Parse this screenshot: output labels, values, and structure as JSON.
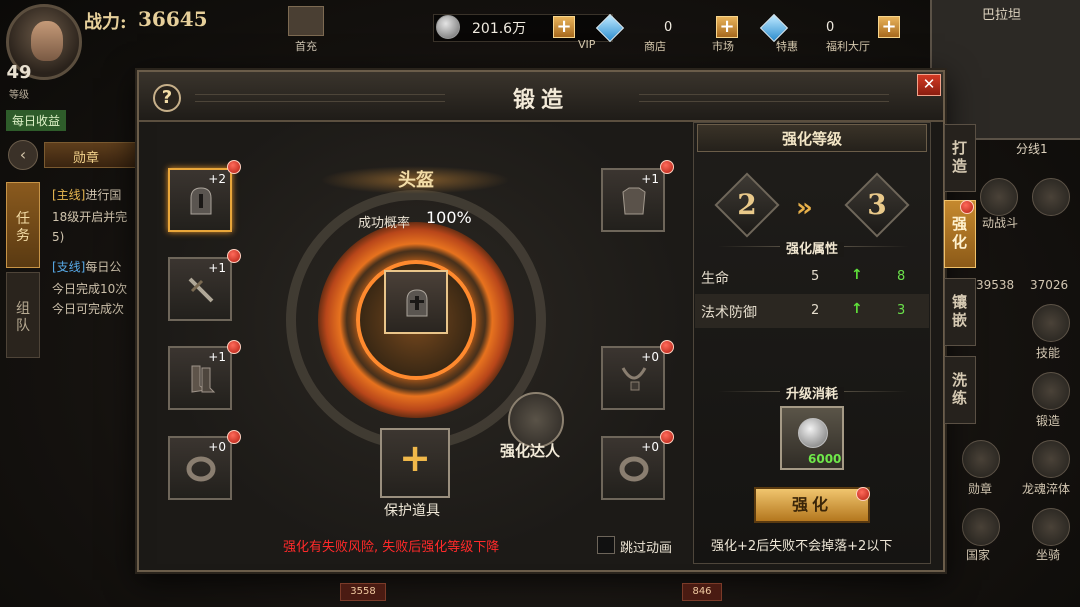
{
  "hud": {
    "power_label": "战力:",
    "power_value": "36645",
    "level_value": "49",
    "level_label": "等级",
    "gift_label": "首充",
    "coin_value": "201.6万",
    "vip_label": "VIP",
    "gem_value": "0",
    "shop_label": "商店",
    "market_label": "市场",
    "special_label": "特惠",
    "gem2_value": "0",
    "welfare_label": "福利大厅",
    "map_title": "巴拉坦",
    "map_line": "分线1"
  },
  "left": {
    "daily_label": "每日收益",
    "medal_tab": "勋章",
    "task_tab": "任务",
    "team_tab": "组队",
    "quests": [
      {
        "tag": "[主线]",
        "text": "进行国"
      },
      {
        "tag": "",
        "text": "18级开启并完"
      },
      {
        "tag": "",
        "text": "5)"
      },
      {
        "tag": "[支线]",
        "text": "每日公"
      },
      {
        "tag": "",
        "text": "今日完成10次"
      },
      {
        "tag": "",
        "text": "今日可完成次"
      }
    ]
  },
  "right": {
    "labels": [
      "动战斗",
      "37026",
      "39538",
      "技能",
      "锻造",
      "龙魂淬体",
      "勋章",
      "国家",
      "坐骑"
    ]
  },
  "modal": {
    "title": "锻造",
    "help": "?",
    "close": "✕",
    "item_name": "头盔",
    "rate_label": "成功概率",
    "rate_value": "100%",
    "slots": [
      {
        "plus": "+2"
      },
      {
        "plus": "+1"
      },
      {
        "plus": "+1"
      },
      {
        "plus": "+0"
      },
      {
        "plus": "+1"
      },
      {
        "plus": "+0"
      },
      {
        "plus": "+0"
      }
    ],
    "master_label": "强化达人",
    "protect_plus": "+",
    "protect_label": "保护道具",
    "warning": "强化有失败风险, 失败后强化等级下降",
    "skip_label": "跳过动画"
  },
  "panel": {
    "title": "强化等级",
    "level_from": "2",
    "level_to": "3",
    "arrow": "»",
    "attr_title": "强化属性",
    "attrs": [
      {
        "name": "生命",
        "old": "5",
        "up": "↑",
        "new": "8"
      },
      {
        "name": "法术防御",
        "old": "2",
        "up": "↑",
        "new": "3"
      }
    ],
    "cost_title": "升级消耗",
    "cost_value": "6000",
    "button": "强化",
    "note": "强化+2后失败不会掉落+2以下"
  },
  "side_tabs": [
    {
      "label": "打造",
      "active": false
    },
    {
      "label": "强化",
      "active": true
    },
    {
      "label": "镶嵌",
      "active": false
    },
    {
      "label": "洗练",
      "active": false
    }
  ],
  "bottom": {
    "chip1": "3558",
    "chip2": "846"
  },
  "colors": {
    "accent_gold": "#e9a63a",
    "warning_red": "#ff2a2a",
    "stat_green": "#6ae04a"
  }
}
